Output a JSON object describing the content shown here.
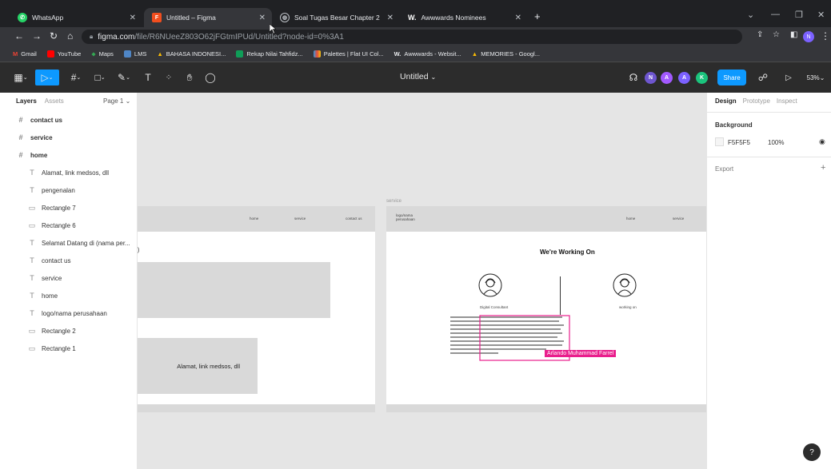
{
  "browser": {
    "tabs": [
      {
        "title": "WhatsApp",
        "favicon": "whatsapp-icon",
        "active": false
      },
      {
        "title": "Untitled – Figma",
        "favicon": "figma-icon",
        "active": true
      },
      {
        "title": "Soal Tugas Besar Chapter 2",
        "favicon": "globe-icon",
        "active": false
      },
      {
        "title": "Awwwards Nominees",
        "favicon": "awwwards-icon",
        "active": false
      }
    ],
    "new_tab": "+",
    "url_host": "figma.com",
    "url_path": "/file/R6NUeeZ803O62jFGtmIPUd/Untitled?node-id=0%3A1",
    "bookmarks": [
      "Gmail",
      "YouTube",
      "Maps",
      "LMS",
      "BAHASA INDONESI...",
      "Rekap Nilai Tahfidz...",
      "Palettes | Flat UI Col...",
      "Awwwards - Websit...",
      "MEMORIES - Googl..."
    ]
  },
  "figma": {
    "file_title": "Untitled",
    "zoom": "53%",
    "share_label": "Share",
    "avatars": [
      {
        "letter": "N",
        "color": "#6e56cf"
      },
      {
        "letter": "A",
        "color": "#a259ff"
      },
      {
        "letter": "A",
        "color": "#7b61ff"
      },
      {
        "letter": "K",
        "color": "#1bc47d"
      }
    ],
    "own_avatar": "N"
  },
  "layers_panel": {
    "tab_layers": "Layers",
    "tab_assets": "Assets",
    "page": "Page 1",
    "frames": [
      {
        "name": "contact us",
        "icon": "frame-icon"
      },
      {
        "name": "service",
        "icon": "frame-icon"
      },
      {
        "name": "home",
        "icon": "frame-icon"
      }
    ],
    "children": [
      {
        "name": "Alamat, link medsos, dll",
        "icon": "text-icon"
      },
      {
        "name": "pengenalan",
        "icon": "text-icon"
      },
      {
        "name": "Rectangle 7",
        "icon": "rectangle-icon"
      },
      {
        "name": "Rectangle 6",
        "icon": "rectangle-icon"
      },
      {
        "name": "Selamat Datang di (nama per...",
        "icon": "text-icon"
      },
      {
        "name": "contact us",
        "icon": "text-icon"
      },
      {
        "name": "service",
        "icon": "text-icon"
      },
      {
        "name": "home",
        "icon": "text-icon"
      },
      {
        "name": "logo/nama perusahaan",
        "icon": "text-icon"
      },
      {
        "name": "Rectangle 2",
        "icon": "rectangle-icon"
      },
      {
        "name": "Rectangle 1",
        "icon": "rectangle-icon"
      }
    ]
  },
  "canvas": {
    "home_frame": {
      "nav": [
        "home",
        "service",
        "contact us"
      ],
      "heading_fragment": ")",
      "footer_text": "Alamat, link medsos, dll"
    },
    "service_frame": {
      "label": "service",
      "logo": "logo/nama perusahaan",
      "nav": [
        "home",
        "service"
      ],
      "heading": "We're Working On",
      "person1": "Digital Consultant",
      "person2": "working on",
      "cursor_label": "Arlando Muhammad Farrel"
    }
  },
  "design_panel": {
    "tabs": [
      "Design",
      "Prototype",
      "Inspect"
    ],
    "background_label": "Background",
    "bg_color": "F5F5F5",
    "bg_opacity": "100%",
    "export_label": "Export"
  }
}
